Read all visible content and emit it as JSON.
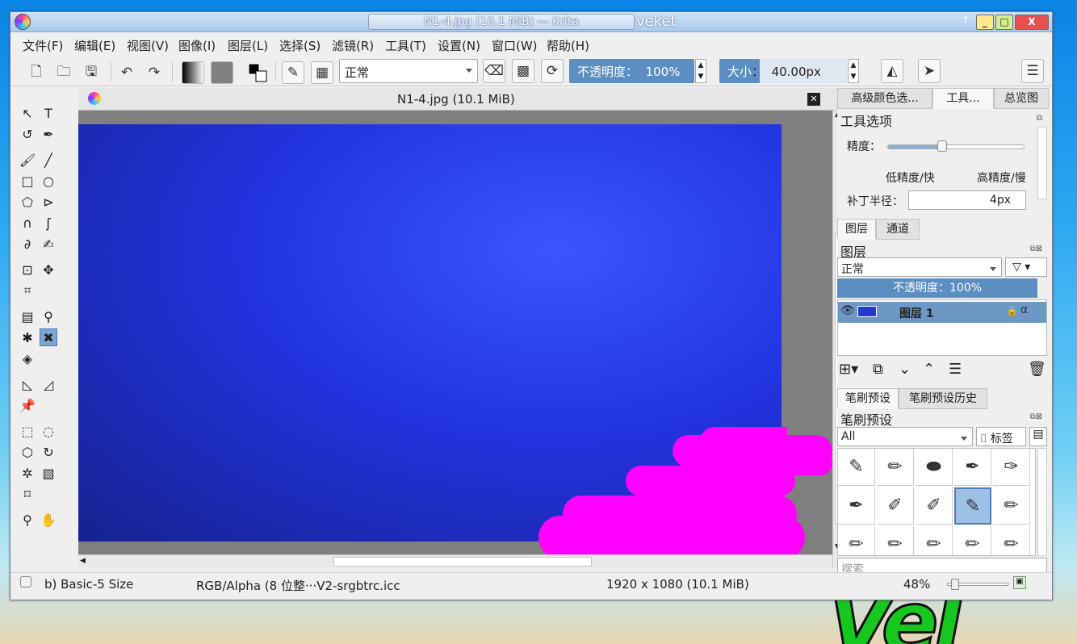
{
  "window": {
    "title": "N1-4.jpg (10.1 MiB) — Krita",
    "host": "veket",
    "btn_help": "↑",
    "btn_min": "_",
    "btn_max": "□",
    "btn_close": "X"
  },
  "menu": [
    "文件(F)",
    "编辑(E)",
    "视图(V)",
    "图像(I)",
    "图层(L)",
    "选择(S)",
    "滤镜(R)",
    "工具(T)",
    "设置(N)",
    "窗口(W)",
    "帮助(H)"
  ],
  "toolbar": {
    "blend_mode": "正常",
    "opacity_label": "不透明度：",
    "opacity_value": "100%",
    "size_label": "大小",
    "size_value": "40.00px"
  },
  "document": {
    "tab_title": "N1-4.jpg (10.1 MiB)",
    "close": "✕"
  },
  "right_tabs": [
    "高级颜色选...",
    "工具...",
    "总览图"
  ],
  "tool_options": {
    "header": "工具选项",
    "precision_label": "精度：",
    "precision_low": "低精度/快",
    "precision_high": "高精度/慢",
    "precision_level": 0.4,
    "patch_label": "补丁半径：",
    "patch_value": "4px"
  },
  "layers_tabs": [
    "图层",
    "通道"
  ],
  "layers": {
    "header": "图层",
    "blend": "正常",
    "opacity": "不透明度：100%",
    "items": [
      {
        "name": "图层 1"
      }
    ]
  },
  "brush_tabs": [
    "笔刷预设",
    "笔刷预设历史"
  ],
  "brushes": {
    "header": "笔刷预设",
    "filter": "All",
    "tag_label": "标签",
    "search_placeholder": "搜索"
  },
  "status": {
    "brush": "b) Basic-5 Size",
    "color": "RGB/Alpha (8 位整···V2-srgbtrc.icc",
    "dims": "1920 x 1080 (10.1 MiB)",
    "zoom": "48%"
  },
  "colors": {
    "accent": "#5b8ec2",
    "canvas": "#2233e0",
    "stroke": "#ff00ff"
  }
}
